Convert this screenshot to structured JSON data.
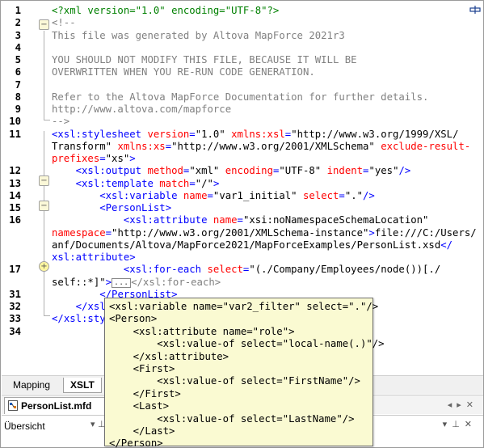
{
  "editor": {
    "lines": [
      {
        "num": "1",
        "segments": [
          [
            "c-dec",
            "<?xml version=\"1.0\" encoding=\"UTF-8\"?>"
          ]
        ]
      },
      {
        "num": "2",
        "segments": [
          [
            "c-com",
            "<!--"
          ]
        ]
      },
      {
        "num": "3",
        "segments": [
          [
            "c-com",
            "This file was generated by Altova MapForce 2021r3"
          ]
        ]
      },
      {
        "num": "4",
        "segments": []
      },
      {
        "num": "5",
        "segments": [
          [
            "c-com",
            "YOU SHOULD NOT MODIFY THIS FILE, BECAUSE IT WILL BE"
          ]
        ]
      },
      {
        "num": "6",
        "segments": [
          [
            "c-com",
            "OVERWRITTEN WHEN YOU RE-RUN CODE GENERATION."
          ]
        ]
      },
      {
        "num": "7",
        "segments": []
      },
      {
        "num": "8",
        "segments": [
          [
            "c-com",
            "Refer to the Altova MapForce Documentation for further details."
          ]
        ]
      },
      {
        "num": "9",
        "segments": [
          [
            "c-com",
            "http://www.altova.com/mapforce"
          ]
        ]
      },
      {
        "num": "10",
        "segments": [
          [
            "c-com",
            "-->"
          ]
        ]
      },
      {
        "num": "11",
        "segments": [
          [
            "c-pun",
            "<"
          ],
          [
            "c-tag",
            "xsl:stylesheet"
          ],
          [
            "c-txt",
            " "
          ],
          [
            "c-att",
            "version"
          ],
          [
            "c-pun",
            "="
          ],
          [
            "c-val",
            "\"1.0\""
          ],
          [
            "c-txt",
            " "
          ],
          [
            "c-att",
            "xmlns:xsl"
          ],
          [
            "c-pun",
            "="
          ],
          [
            "c-val",
            "\"http://www.w3.org/1999/XSL/"
          ]
        ]
      },
      {
        "num": "",
        "segments": [
          [
            "c-val",
            "Transform\""
          ],
          [
            "c-txt",
            " "
          ],
          [
            "c-att",
            "xmlns:xs"
          ],
          [
            "c-pun",
            "="
          ],
          [
            "c-val",
            "\"http://www.w3.org/2001/XMLSchema\""
          ],
          [
            "c-txt",
            " "
          ],
          [
            "c-att",
            "exclude-result-"
          ]
        ]
      },
      {
        "num": "",
        "segments": [
          [
            "c-att",
            "prefixes"
          ],
          [
            "c-pun",
            "="
          ],
          [
            "c-val",
            "\"xs\""
          ],
          [
            "c-pun",
            ">"
          ]
        ]
      },
      {
        "num": "12",
        "segments": [
          [
            "c-txt",
            "    "
          ],
          [
            "c-pun",
            "<"
          ],
          [
            "c-tag",
            "xsl:output"
          ],
          [
            "c-txt",
            " "
          ],
          [
            "c-att",
            "method"
          ],
          [
            "c-pun",
            "="
          ],
          [
            "c-val",
            "\"xml\""
          ],
          [
            "c-txt",
            " "
          ],
          [
            "c-att",
            "encoding"
          ],
          [
            "c-pun",
            "="
          ],
          [
            "c-val",
            "\"UTF-8\""
          ],
          [
            "c-txt",
            " "
          ],
          [
            "c-att",
            "indent"
          ],
          [
            "c-pun",
            "="
          ],
          [
            "c-val",
            "\"yes\""
          ],
          [
            "c-pun",
            "/>"
          ]
        ]
      },
      {
        "num": "13",
        "segments": [
          [
            "c-txt",
            "    "
          ],
          [
            "c-pun",
            "<"
          ],
          [
            "c-tag",
            "xsl:template"
          ],
          [
            "c-txt",
            " "
          ],
          [
            "c-att",
            "match"
          ],
          [
            "c-pun",
            "="
          ],
          [
            "c-val",
            "\"/\""
          ],
          [
            "c-pun",
            ">"
          ]
        ]
      },
      {
        "num": "14",
        "segments": [
          [
            "c-txt",
            "        "
          ],
          [
            "c-pun",
            "<"
          ],
          [
            "c-tag",
            "xsl:variable"
          ],
          [
            "c-txt",
            " "
          ],
          [
            "c-att",
            "name"
          ],
          [
            "c-pun",
            "="
          ],
          [
            "c-val",
            "\"var1_initial\""
          ],
          [
            "c-txt",
            " "
          ],
          [
            "c-att",
            "select"
          ],
          [
            "c-pun",
            "="
          ],
          [
            "c-val",
            "\".\""
          ],
          [
            "c-pun",
            "/>"
          ]
        ]
      },
      {
        "num": "15",
        "segments": [
          [
            "c-txt",
            "        "
          ],
          [
            "c-pun",
            "<"
          ],
          [
            "c-tag",
            "PersonList"
          ],
          [
            "c-pun",
            ">"
          ]
        ]
      },
      {
        "num": "16",
        "segments": [
          [
            "c-txt",
            "            "
          ],
          [
            "c-pun",
            "<"
          ],
          [
            "c-tag",
            "xsl:attribute"
          ],
          [
            "c-txt",
            " "
          ],
          [
            "c-att",
            "name"
          ],
          [
            "c-pun",
            "="
          ],
          [
            "c-val",
            "\"xsi:noNamespaceSchemaLocation\""
          ]
        ]
      },
      {
        "num": "",
        "segments": [
          [
            "c-att",
            "namespace"
          ],
          [
            "c-pun",
            "="
          ],
          [
            "c-val",
            "\"http://www.w3.org/2001/XMLSchema-instance\""
          ],
          [
            "c-pun",
            ">"
          ],
          [
            "c-txt",
            "file:///C:/Users/"
          ]
        ]
      },
      {
        "num": "",
        "segments": [
          [
            "c-txt",
            "anf/Documents/Altova/MapForce2021/MapForceExamples/PersonList.xsd"
          ],
          [
            "c-pun",
            "</"
          ]
        ]
      },
      {
        "num": "",
        "segments": [
          [
            "c-tag",
            "xsl:attribute"
          ],
          [
            "c-pun",
            ">"
          ]
        ]
      },
      {
        "num": "17",
        "segments": [
          [
            "c-txt",
            "            "
          ],
          [
            "c-pun",
            "<"
          ],
          [
            "c-tag",
            "xsl:for-each"
          ],
          [
            "c-txt",
            " "
          ],
          [
            "c-att",
            "select"
          ],
          [
            "c-pun",
            "="
          ],
          [
            "c-val",
            "\"(./Company/Employees/node())[./"
          ]
        ]
      },
      {
        "num": "",
        "segments": [
          [
            "c-val",
            "self::*]\""
          ],
          [
            "c-pun",
            ">"
          ],
          [
            "ellipsis",
            "..."
          ],
          [
            "c-com",
            "</xsl:for-each>"
          ]
        ]
      },
      {
        "num": "31",
        "segments": [
          [
            "c-txt",
            "        "
          ],
          [
            "c-pun",
            "</"
          ],
          [
            "c-tag",
            "PersonList"
          ],
          [
            "c-pun",
            ">"
          ]
        ]
      },
      {
        "num": "32",
        "segments": [
          [
            "c-txt",
            "    "
          ],
          [
            "c-pun",
            "</"
          ],
          [
            "c-tag",
            "xsl"
          ]
        ]
      },
      {
        "num": "33",
        "segments": [
          [
            "c-pun",
            "</"
          ],
          [
            "c-tag",
            "xsl:sty"
          ]
        ]
      },
      {
        "num": "34",
        "segments": []
      }
    ]
  },
  "tooltip": {
    "text": "<xsl:variable name=\"var2_filter\" select=\".\"/>\n<Person>\n    <xsl:attribute name=\"role\">\n        <xsl:value-of select=\"local-name(.)\"/>\n    </xsl:attribute>\n    <First>\n        <xsl:value-of select=\"FirstName\"/>\n    </First>\n    <Last>\n        <xsl:value-of select=\"LastName\"/>\n    </Last>\n</Person>"
  },
  "tabs": {
    "mapping": "Mapping",
    "xslt": "XSLT"
  },
  "document": {
    "filename": "PersonList.mfd",
    "icon": "mapforce-file-icon"
  },
  "overview": {
    "title": "Übersicht",
    "pin_icon": "pin-icon",
    "close_icon": "close-icon"
  },
  "colors": {
    "comment": "#808080",
    "tag": "#0000ff",
    "attribute": "#ff0000",
    "declaration": "#008000",
    "tooltip_bg": "#fafad2"
  }
}
